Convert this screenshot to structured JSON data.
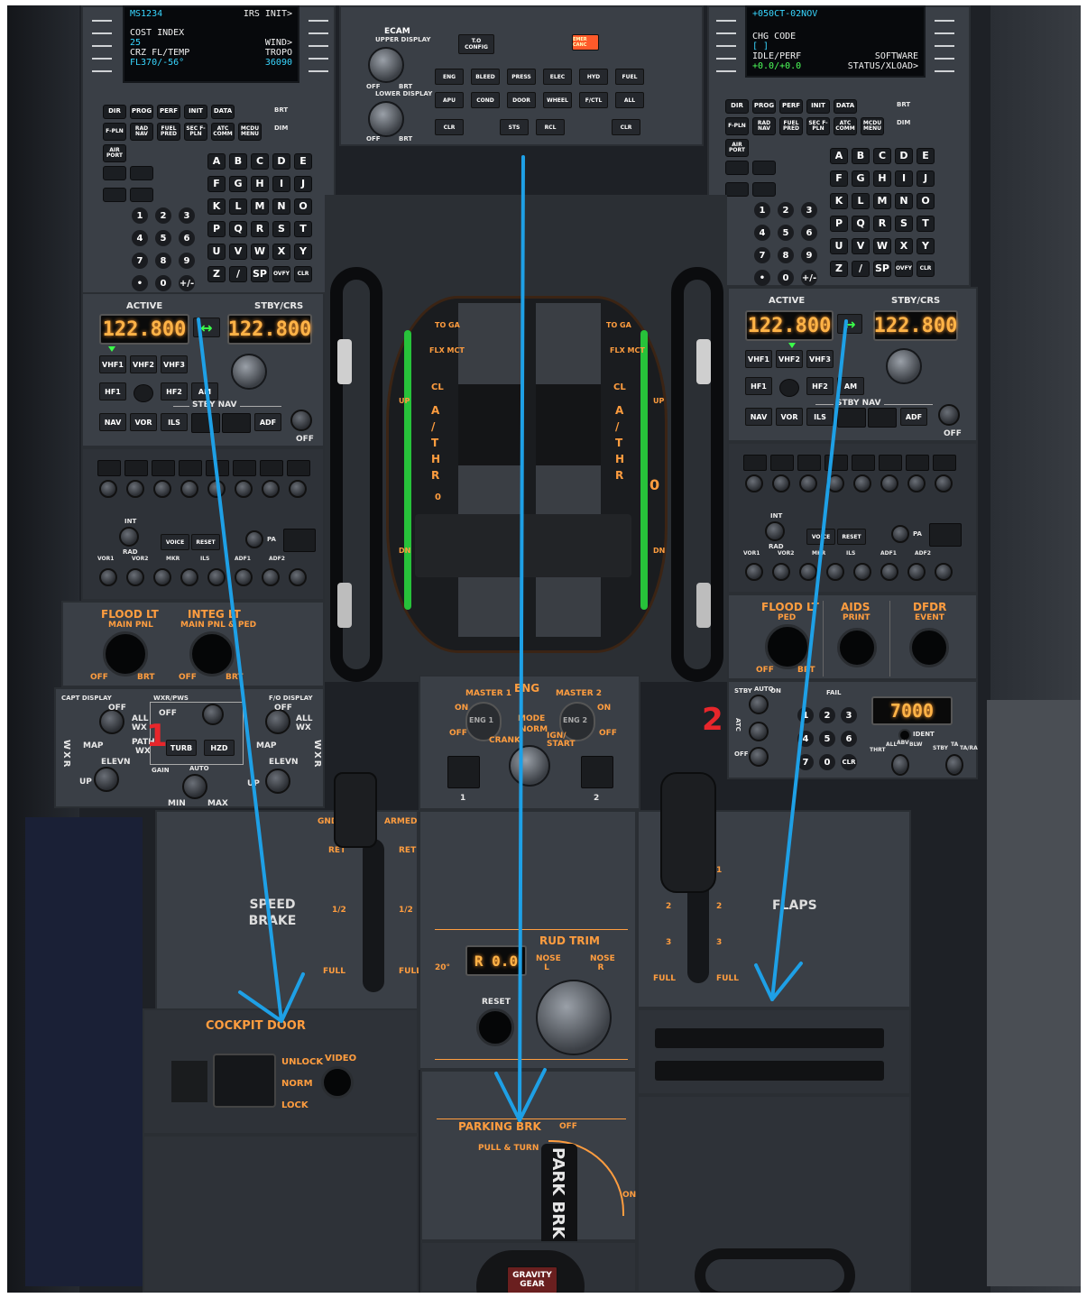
{
  "mcdu_left": {
    "line1_left": "MS1234",
    "line1_right": "IRS INIT>",
    "cost_index_label": "COST INDEX",
    "cost_index_value": "25",
    "wind_label": "WIND>",
    "crz_label": "CRZ FL/TEMP",
    "crz_value": "FL370/-56°",
    "tropo_label": "TROPO",
    "tropo_value": "36090"
  },
  "mcdu_right": {
    "line1": "+050CT-02NOV",
    "chg_code_label": "CHG CODE",
    "chg_code_value": "[ ]",
    "idle_perf_label": "IDLE/PERF",
    "idle_perf_value": "+0.0/+0.0",
    "software_label": "SOFTWARE",
    "status_label": "STATUS/XLOAD>"
  },
  "mcdu_keys": {
    "row1": [
      "DIR",
      "PROG",
      "PERF",
      "INIT",
      "DATA"
    ],
    "row2": [
      "F-PLN",
      "RAD NAV",
      "FUEL PRED",
      "SEC F-PLN",
      "ATC COMM",
      "MCDU MENU"
    ],
    "airport": "AIR PORT",
    "brt": "BRT",
    "dim": "DIM",
    "letters": [
      "A",
      "B",
      "C",
      "D",
      "E",
      "F",
      "G",
      "H",
      "I",
      "J",
      "K",
      "L",
      "M",
      "N",
      "O",
      "P",
      "Q",
      "R",
      "S",
      "T",
      "U",
      "V",
      "W",
      "X",
      "Y",
      "Z",
      "/",
      "SP",
      "OVFY",
      "CLR"
    ],
    "digits": [
      "1",
      "2",
      "3",
      "4",
      "5",
      "6",
      "7",
      "8",
      "9",
      "•",
      "0",
      "+/-"
    ]
  },
  "ecam": {
    "title": "ECAM",
    "upper_display": "UPPER DISPLAY",
    "lower_display": "LOWER DISPLAY",
    "off": "OFF",
    "brt": "BRT",
    "to_config": "T.O CONFIG",
    "emer_canc": "EMER CANC",
    "row1": [
      "ENG",
      "BLEED",
      "PRESS",
      "ELEC",
      "HYD",
      "FUEL"
    ],
    "row2": [
      "APU",
      "COND",
      "DOOR",
      "WHEEL",
      "F/CTL",
      "ALL"
    ],
    "row3": [
      "CLR",
      "STS",
      "RCL",
      "CLR"
    ]
  },
  "rmp_left": {
    "active_label": "ACTIVE",
    "stby_label": "STBY/CRS",
    "active_freq": "122.800",
    "stby_freq": "122.800",
    "row1": [
      "VHF1",
      "VHF2",
      "VHF3"
    ],
    "row2": [
      "HF1",
      "HF2",
      "AM"
    ],
    "stby_nav": "STBY NAV",
    "row3": [
      "NAV",
      "VOR",
      "ILS",
      "ADF"
    ],
    "off": "OFF"
  },
  "rmp_right": {
    "active_label": "ACTIVE",
    "stby_label": "STBY/CRS",
    "active_freq": "122.800",
    "stby_freq": "122.800",
    "row1": [
      "VHF1",
      "VHF2",
      "VHF3"
    ],
    "row2": [
      "HF1",
      "HF2",
      "AM"
    ],
    "stby_nav": "STBY NAV",
    "row3": [
      "NAV",
      "VOR",
      "ILS",
      "ADF"
    ],
    "off": "OFF"
  },
  "acp": {
    "int": "INT",
    "rad": "RAD",
    "voice": "VOICE",
    "reset": "RESET",
    "pa": "PA",
    "bottom": [
      "VOR1",
      "VOR2",
      "MKR",
      "ILS",
      "ADF1",
      "ADF2"
    ]
  },
  "lighting_left": {
    "flood_title": "FLOOD LT",
    "flood_sub": "MAIN PNL",
    "integ_title": "INTEG LT",
    "integ_sub": "MAIN PNL & PED",
    "off": "OFF",
    "brt": "BRT"
  },
  "lighting_right": {
    "flood_title": "FLOOD LT",
    "flood_sub": "PED",
    "aids_title": "AIDS",
    "aids_sub": "PRINT",
    "dfdr_title": "DFDR",
    "dfdr_sub": "EVENT",
    "off": "OFF",
    "brt": "BRT"
  },
  "wx": {
    "capt_display": "CAPT DISPLAY",
    "wxr_pws": "WXR/PWS",
    "fo_display": "F/O DISPLAY",
    "off": "OFF",
    "all": "ALL",
    "wx": "WX",
    "map": "MAP",
    "path": "PATH",
    "elevn": "ELEVN",
    "up": "UP",
    "wxr_vertical": "WXR",
    "turb": "TURB",
    "hzd": "HZD",
    "gain": "GAIN",
    "auto": "AUTO",
    "min": "MIN",
    "max": "MAX"
  },
  "thrust": {
    "toga": "TO GA",
    "flx_mct": "FLX MCT",
    "cl": "CL",
    "athr": [
      "A",
      "/",
      "T",
      "H",
      "R"
    ],
    "zero": "0",
    "up": "UP",
    "dn": "DN"
  },
  "eng": {
    "title": "ENG",
    "master1": "MASTER 1",
    "master2": "MASTER 2",
    "on": "ON",
    "off": "OFF",
    "eng1": "ENG 1",
    "eng2": "ENG 2",
    "mode": "MODE",
    "norm": "NORM",
    "crank": "CRANK",
    "ign_start": "IGN/ START",
    "fault1": "1",
    "fault2": "2"
  },
  "atc": {
    "stby": "STBY",
    "auto": "AUTO",
    "on": "ON",
    "fail": "FAIL",
    "atc_label": "ATC",
    "off": "OFF",
    "code": "7000",
    "ident": "IDENT",
    "thrt": "THRT",
    "all": "ALL",
    "abv": "ABV",
    "blw": "BLW",
    "stby2": "STBY",
    "ta": "TA",
    "tara": "TA/RA",
    "keys": [
      "1",
      "2",
      "3",
      "4",
      "5",
      "6",
      "7",
      "0",
      "CLR"
    ]
  },
  "speedbrake": {
    "title": "SPEED BRAKE",
    "gnd": "GND",
    "armed": "ARMED",
    "ret": "RET",
    "half": "1/2",
    "full": "FULL"
  },
  "flaps": {
    "title": "FLAPS",
    "marks": [
      "1",
      "2",
      "3",
      "FULL"
    ]
  },
  "rud_trim": {
    "title": "RUD TRIM",
    "display": "R 0.0",
    "nose_l": "NOSE L",
    "nose_r": "NOSE R",
    "deg": "20°",
    "reset": "RESET"
  },
  "cockpit_door": {
    "title": "COCKPIT DOOR",
    "unlock": "UNLOCK",
    "norm": "NORM",
    "lock": "LOCK",
    "video": "VIDEO"
  },
  "parking_brk": {
    "title": "PARKING BRK",
    "sub": "PULL & TURN",
    "off": "OFF",
    "on": "ON",
    "handle": "PARK BRK"
  },
  "gear": {
    "gravity": "GRAVITY",
    "gear": "GEAR"
  },
  "annotations": {
    "marker1": "1",
    "marker2": "2",
    "arrow_color": "#1ea0e6"
  }
}
